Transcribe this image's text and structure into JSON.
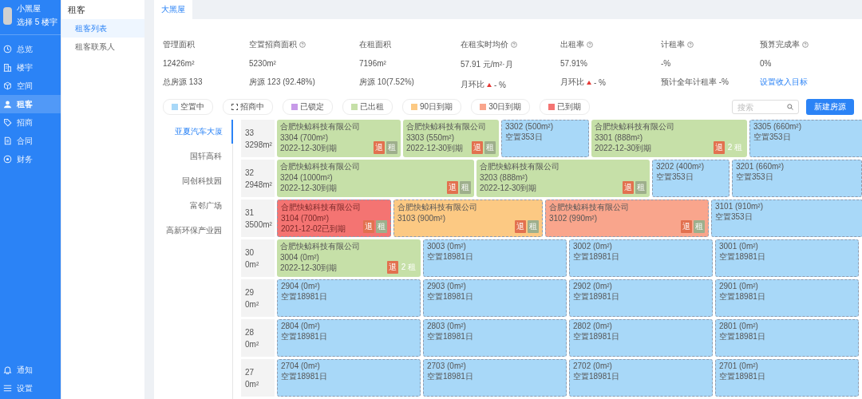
{
  "sidebar": {
    "user": {
      "name": "小黑屋",
      "subtitle": "选择 5 楼宇"
    },
    "items": [
      {
        "label": "总览",
        "kind": "overview",
        "selected": false
      },
      {
        "label": "楼宇",
        "kind": "building",
        "selected": false
      },
      {
        "label": "空间",
        "kind": "space",
        "selected": false
      },
      {
        "label": "租客",
        "kind": "tenant",
        "selected": true
      },
      {
        "label": "招商",
        "kind": "tag",
        "selected": false
      },
      {
        "label": "合同",
        "kind": "contract",
        "selected": false
      },
      {
        "label": "财务",
        "kind": "finance",
        "selected": false
      }
    ],
    "bottom_items": [
      {
        "label": "通知",
        "kind": "bell"
      },
      {
        "label": "设置",
        "kind": "menu"
      }
    ]
  },
  "submenu": {
    "title": "租客",
    "items": [
      {
        "label": "租客列表",
        "selected": true
      },
      {
        "label": "租客联系人",
        "selected": false
      }
    ]
  },
  "tabs": [
    {
      "label": "大黑屋",
      "selected": true
    }
  ],
  "stats": [
    {
      "title": "管理面积",
      "help": false,
      "value": "12426m²",
      "sub": {
        "kind": "text",
        "text": "总房源 133"
      }
    },
    {
      "title": "空置招商面积",
      "help": true,
      "value": "5230m²",
      "sub": {
        "kind": "text",
        "text": "房源 123 (92.48%)"
      }
    },
    {
      "title": "在租面积",
      "help": false,
      "value": "7196m²",
      "sub": {
        "kind": "text",
        "text": "房源 10(7.52%)"
      }
    },
    {
      "title": "在租实时均价",
      "help": true,
      "value": "57.91 元/m²·月",
      "sub": {
        "kind": "trend",
        "text": "月环比",
        "tail": "- %"
      }
    },
    {
      "title": "出租率",
      "help": true,
      "value": "57.91%",
      "sub": {
        "kind": "trend",
        "text": "月环比",
        "tail": "- %"
      }
    },
    {
      "title": "计租率",
      "help": true,
      "value": "-%",
      "sub": {
        "kind": "text",
        "text": "预计全年计租率 -%"
      }
    },
    {
      "title": "预算完成率",
      "help": true,
      "value": "0%",
      "sub": {
        "kind": "link",
        "text": "设置收入目标"
      }
    }
  ],
  "legend": [
    {
      "label": "空置中",
      "kind": "swatch",
      "color": "#a8d8f8"
    },
    {
      "label": "招商中",
      "kind": "bracket",
      "color": "#555555"
    },
    {
      "label": "已锁定",
      "kind": "swatch",
      "color": "#c79ae8"
    },
    {
      "label": "已出租",
      "kind": "swatch",
      "color": "#c6e0a8"
    },
    {
      "label": "90日到期",
      "kind": "swatch",
      "color": "#fcc983"
    },
    {
      "label": "30日到期",
      "kind": "swatch",
      "color": "#f9a58c"
    },
    {
      "label": "已到期",
      "kind": "swatch",
      "color": "#f47472"
    }
  ],
  "search": {
    "placeholder": "搜索"
  },
  "new_button": "新建房源",
  "buildings": [
    {
      "label": "亚夏汽车大厦",
      "selected": true
    },
    {
      "label": "国轩高科",
      "selected": false
    },
    {
      "label": "同创科技园",
      "selected": false
    },
    {
      "label": "富邻广场",
      "selected": false
    },
    {
      "label": "高新环保产业园",
      "selected": false
    }
  ],
  "floors": [
    {
      "floor": "33",
      "area": "3298m²",
      "units": [
        {
          "kind": "rented",
          "lines": [
            "合肥快鲸科技有限公司",
            "3304 (700m²)",
            "2022-12-30到期"
          ],
          "tags": [
            {
              "kind": "return",
              "text": "退"
            },
            {
              "kind": "rent",
              "text": "租"
            }
          ]
        },
        {
          "kind": "rented",
          "lines": [
            "合肥快鲸科技有限公司",
            "3303 (550m²)",
            "2022-12-30到期"
          ],
          "tags": [
            {
              "kind": "return",
              "text": "退"
            },
            {
              "kind": "rent",
              "text": "租"
            }
          ]
        },
        {
          "kind": "vacant",
          "lines": [
            "3302 (500m²)",
            "空置353日"
          ]
        },
        {
          "kind": "rented",
          "lines": [
            "合肥快鲸科技有限公司",
            "3301 (888m²)",
            "2022-12-30到期"
          ],
          "tags": [
            {
              "kind": "return",
              "text": "退"
            },
            {
              "kind": "count",
              "text": "2 租"
            }
          ]
        },
        {
          "kind": "vacant",
          "lines": [
            "3305 (660m²)",
            "空置353日"
          ]
        }
      ]
    },
    {
      "floor": "32",
      "area": "2948m²",
      "units": [
        {
          "kind": "rented",
          "lines": [
            "合肥快鲸科技有限公司",
            "3204 (1000m²)",
            "2022-12-30到期"
          ],
          "tags": [
            {
              "kind": "return",
              "text": "退"
            },
            {
              "kind": "rent",
              "text": "租"
            }
          ]
        },
        {
          "kind": "rented",
          "lines": [
            "合肥快鲸科技有限公司",
            "3203 (888m²)",
            "2022-12-30到期"
          ],
          "tags": [
            {
              "kind": "return",
              "text": "退"
            },
            {
              "kind": "rent",
              "text": "租"
            }
          ]
        },
        {
          "kind": "vacant",
          "lines": [
            "3202 (400m²)",
            "空置353日"
          ]
        },
        {
          "kind": "vacant",
          "lines": [
            "3201 (660m²)",
            "空置353日"
          ]
        }
      ]
    },
    {
      "floor": "31",
      "area": "3500m²",
      "units": [
        {
          "kind": "expired",
          "lines": [
            "合肥快鲸科技有限公司",
            "3104 (700m²)",
            "2021-12-02已到期"
          ],
          "tags": [
            {
              "kind": "return",
              "text": "退"
            },
            {
              "kind": "rent",
              "text": "租"
            }
          ]
        },
        {
          "kind": "due90",
          "lines": [
            "合肥快鲸科技有限公司",
            "3103 (900m²)"
          ],
          "tags": [
            {
              "kind": "return",
              "text": "退"
            },
            {
              "kind": "rent",
              "text": "租"
            }
          ]
        },
        {
          "kind": "due30",
          "lines": [
            "合肥快鲸科技有限公司",
            "3102 (990m²)"
          ],
          "tags": [
            {
              "kind": "return",
              "text": "退"
            },
            {
              "kind": "rent",
              "text": "租"
            }
          ]
        },
        {
          "kind": "vacant",
          "lines": [
            "3101 (910m²)",
            "空置353日"
          ]
        }
      ]
    },
    {
      "floor": "30",
      "area": "0m²",
      "units": [
        {
          "kind": "rented",
          "lines": [
            "合肥快鲸科技有限公司",
            "3004 (0m²)",
            "2022-12-30到期"
          ],
          "tags": [
            {
              "kind": "return",
              "text": "退"
            },
            {
              "kind": "count",
              "text": "2 租"
            }
          ]
        },
        {
          "kind": "vacant",
          "lines": [
            "3003 (0m²)",
            "空置18981日"
          ]
        },
        {
          "kind": "vacant",
          "lines": [
            "3002 (0m²)",
            "空置18981日"
          ]
        },
        {
          "kind": "vacant",
          "lines": [
            "3001 (0m²)",
            "空置18981日"
          ]
        }
      ]
    },
    {
      "floor": "29",
      "area": "0m²",
      "units": [
        {
          "kind": "vacant",
          "lines": [
            "2904 (0m²)",
            "空置18981日"
          ]
        },
        {
          "kind": "vacant",
          "lines": [
            "2903 (0m²)",
            "空置18981日"
          ]
        },
        {
          "kind": "vacant",
          "lines": [
            "2902 (0m²)",
            "空置18981日"
          ]
        },
        {
          "kind": "vacant",
          "lines": [
            "2901 (0m²)",
            "空置18981日"
          ]
        }
      ]
    },
    {
      "floor": "28",
      "area": "0m²",
      "units": [
        {
          "kind": "vacant",
          "lines": [
            "2804 (0m²)",
            "空置18981日"
          ]
        },
        {
          "kind": "vacant",
          "lines": [
            "2803 (0m²)",
            "空置18981日"
          ]
        },
        {
          "kind": "vacant",
          "lines": [
            "2802 (0m²)",
            "空置18981日"
          ]
        },
        {
          "kind": "vacant",
          "lines": [
            "2801 (0m²)",
            "空置18981日"
          ]
        }
      ]
    },
    {
      "floor": "27",
      "area": "0m²",
      "units": [
        {
          "kind": "vacant",
          "lines": [
            "2704 (0m²)",
            "空置18981日"
          ]
        },
        {
          "kind": "vacant",
          "lines": [
            "2703 (0m²)",
            "空置18981日"
          ]
        },
        {
          "kind": "vacant",
          "lines": [
            "2702 (0m²)",
            "空置18981日"
          ]
        },
        {
          "kind": "vacant",
          "lines": [
            "2701 (0m²)",
            "空置18981日"
          ]
        }
      ]
    }
  ]
}
